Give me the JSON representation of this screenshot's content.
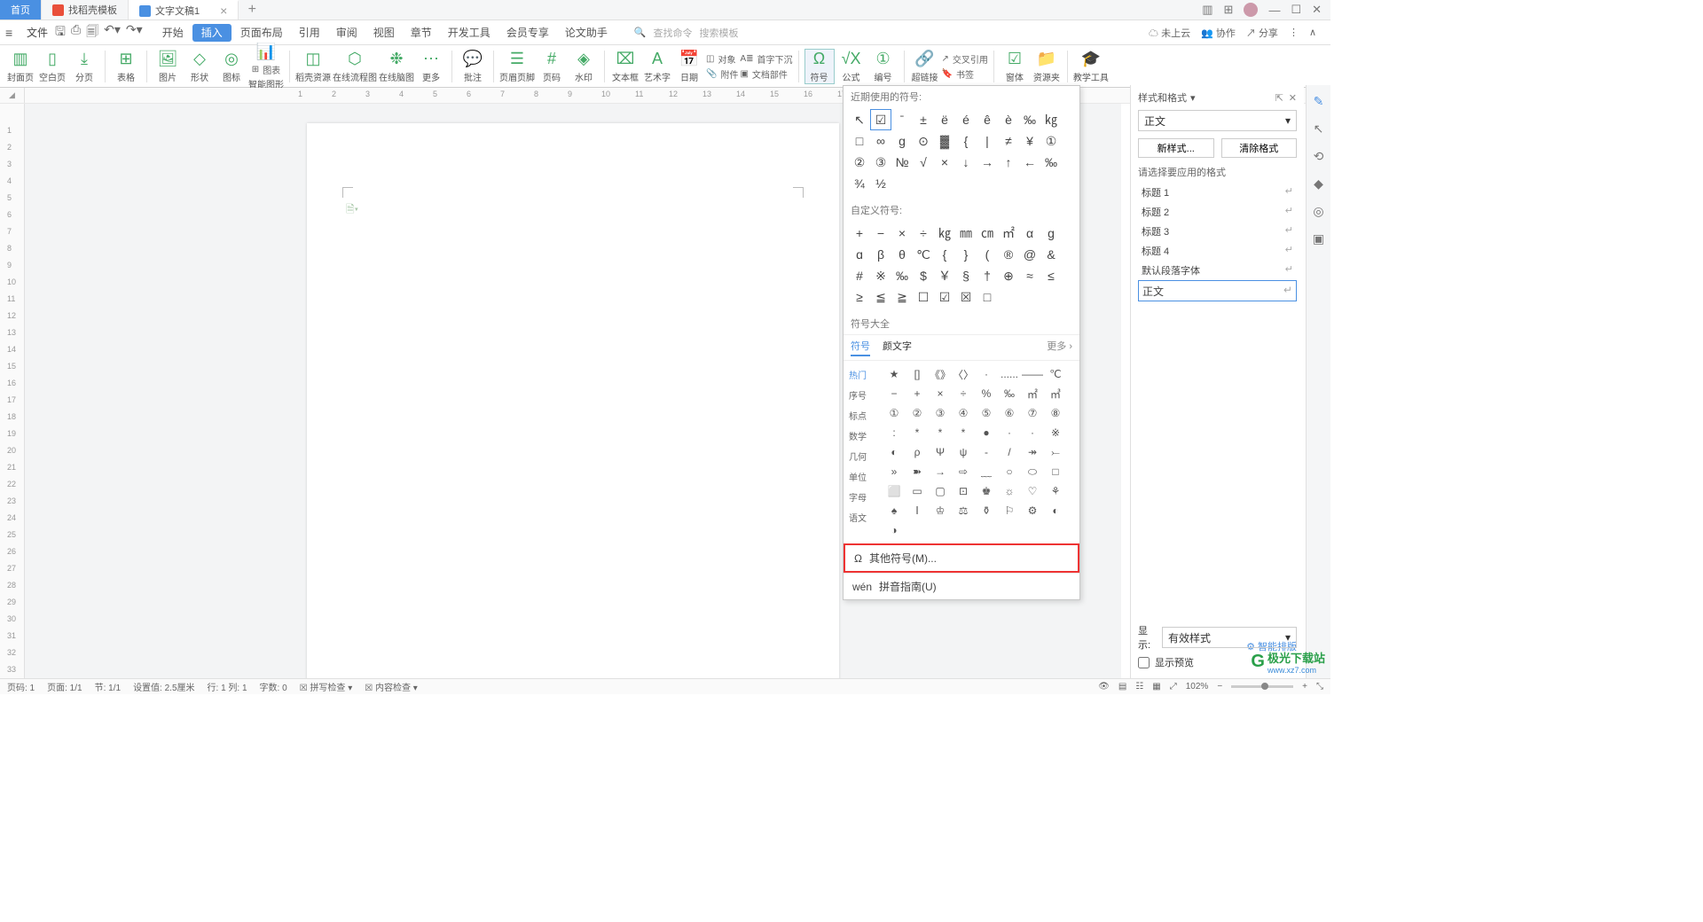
{
  "titlebar": {
    "tabs": [
      {
        "label": "首页"
      },
      {
        "label": "找稻壳模板"
      },
      {
        "label": "文字文稿1"
      }
    ]
  },
  "menubar": {
    "file": "文件",
    "tabs": [
      "开始",
      "插入",
      "页面布局",
      "引用",
      "审阅",
      "视图",
      "章节",
      "开发工具",
      "会员专享",
      "论文助手"
    ],
    "activeTab": "插入",
    "searchCmd": "查找命令",
    "searchTpl": "搜索模板",
    "right": [
      "未上云",
      "协作",
      "分享"
    ]
  },
  "ribbon": [
    {
      "label": "封面页"
    },
    {
      "label": "空白页"
    },
    {
      "label": "分页"
    },
    {
      "label": "表格"
    },
    {
      "label": "图片"
    },
    {
      "label": "形状"
    },
    {
      "label": "图标"
    },
    {
      "label": "智能图形",
      "extra": "图表"
    },
    {
      "label": "稻壳资源"
    },
    {
      "label": "在线流程图"
    },
    {
      "label": "在线脑图"
    },
    {
      "label": "更多"
    },
    {
      "label": "批注"
    },
    {
      "label": "页眉页脚"
    },
    {
      "label": "页码"
    },
    {
      "label": "水印"
    },
    {
      "label": "文本框"
    },
    {
      "label": "艺术字"
    },
    {
      "label": "日期"
    },
    {
      "label": "附件",
      "extra": "对象"
    },
    {
      "label": "文档部件",
      "extra": "首字下沉"
    },
    {
      "label": "符号"
    },
    {
      "label": "公式"
    },
    {
      "label": "编号"
    },
    {
      "label": "超链接"
    },
    {
      "label": "书签",
      "extra": "交叉引用"
    },
    {
      "label": "窗体"
    },
    {
      "label": "资源夹"
    },
    {
      "label": "教学工具"
    }
  ],
  "symbols": {
    "recentLabel": "近期使用的符号:",
    "recent": [
      "↖",
      "☑",
      "ˉ",
      "±",
      "ë",
      "é",
      "ê",
      "è",
      "‰",
      "㎏",
      "□",
      "∞",
      "ɡ",
      "⊙",
      "▓",
      "{",
      "|",
      "≠",
      "¥",
      "①",
      "②",
      "③",
      "№",
      "√",
      "×",
      "↓",
      "→",
      "↑",
      "←",
      "‰",
      "¾",
      "½"
    ],
    "customLabel": "自定义符号:",
    "custom": [
      "+",
      "−",
      "×",
      "÷",
      "㎏",
      "㎜",
      "㎝",
      "㎡",
      "α",
      "g",
      "ɑ",
      "β",
      "θ",
      "℃",
      "{",
      "}",
      "(",
      "®",
      "@",
      "&",
      "#",
      "※",
      "‰",
      "$",
      "￥",
      "§",
      "†",
      "⊕",
      "≈",
      "≤",
      "≥",
      "≦",
      "≧",
      "☐",
      "☑",
      "☒",
      "□"
    ],
    "allLabel": "符号大全",
    "tabs": [
      "符号",
      "颜文字"
    ],
    "more": "更多",
    "cats": [
      "热门",
      "序号",
      "标点",
      "数学",
      "几何",
      "单位",
      "字母",
      "语文"
    ],
    "grid": [
      "★",
      "[]",
      "《》",
      "〈〉",
      "·",
      "......",
      "——",
      "℃",
      "−",
      "+",
      "×",
      "÷",
      "%",
      "‰",
      "㎡",
      "㎥",
      "①",
      "②",
      "③",
      "④",
      "⑤",
      "⑥",
      "⑦",
      "⑧",
      ":",
      "*",
      "*",
      "*",
      "●",
      "·",
      "·",
      "※",
      "◐",
      "ρ",
      "Ψ",
      "ψ",
      "-",
      "/",
      "↠",
      "⤚",
      "»",
      "➽",
      "→",
      "⇨",
      "﹏",
      "○",
      "⬭",
      "□",
      "⬜",
      "▭",
      "▢",
      "⊡",
      "♚",
      "☼",
      "♡",
      "⚘",
      "♠",
      "Ⅰ",
      "♔",
      "⚖",
      "⚱",
      "⚐",
      "⚙",
      "◐",
      "◑"
    ],
    "otherSymbols": "其他符号(M)...",
    "pinyin": "拼音指南(U)"
  },
  "stylespane": {
    "title": "样式和格式",
    "current": "正文",
    "newStyle": "新样式...",
    "clearFmt": "清除格式",
    "pick": "请选择要应用的格式",
    "items": [
      "标题 1",
      "标题 2",
      "标题 3",
      "标题 4",
      "默认段落字体",
      "正文"
    ],
    "showLabel": "显示:",
    "showValue": "有效样式",
    "preview": "显示预览",
    "smart": "智能排版"
  },
  "statusbar": {
    "items": [
      "页码: 1",
      "页面: 1/1",
      "节: 1/1",
      "设置值: 2.5厘米",
      "行: 1  列: 1",
      "字数: 0",
      "拼写检查",
      "内容检查"
    ],
    "zoom": "102%"
  },
  "watermark": {
    "brand": "极光下载站",
    "url": "www.xz7.com"
  }
}
